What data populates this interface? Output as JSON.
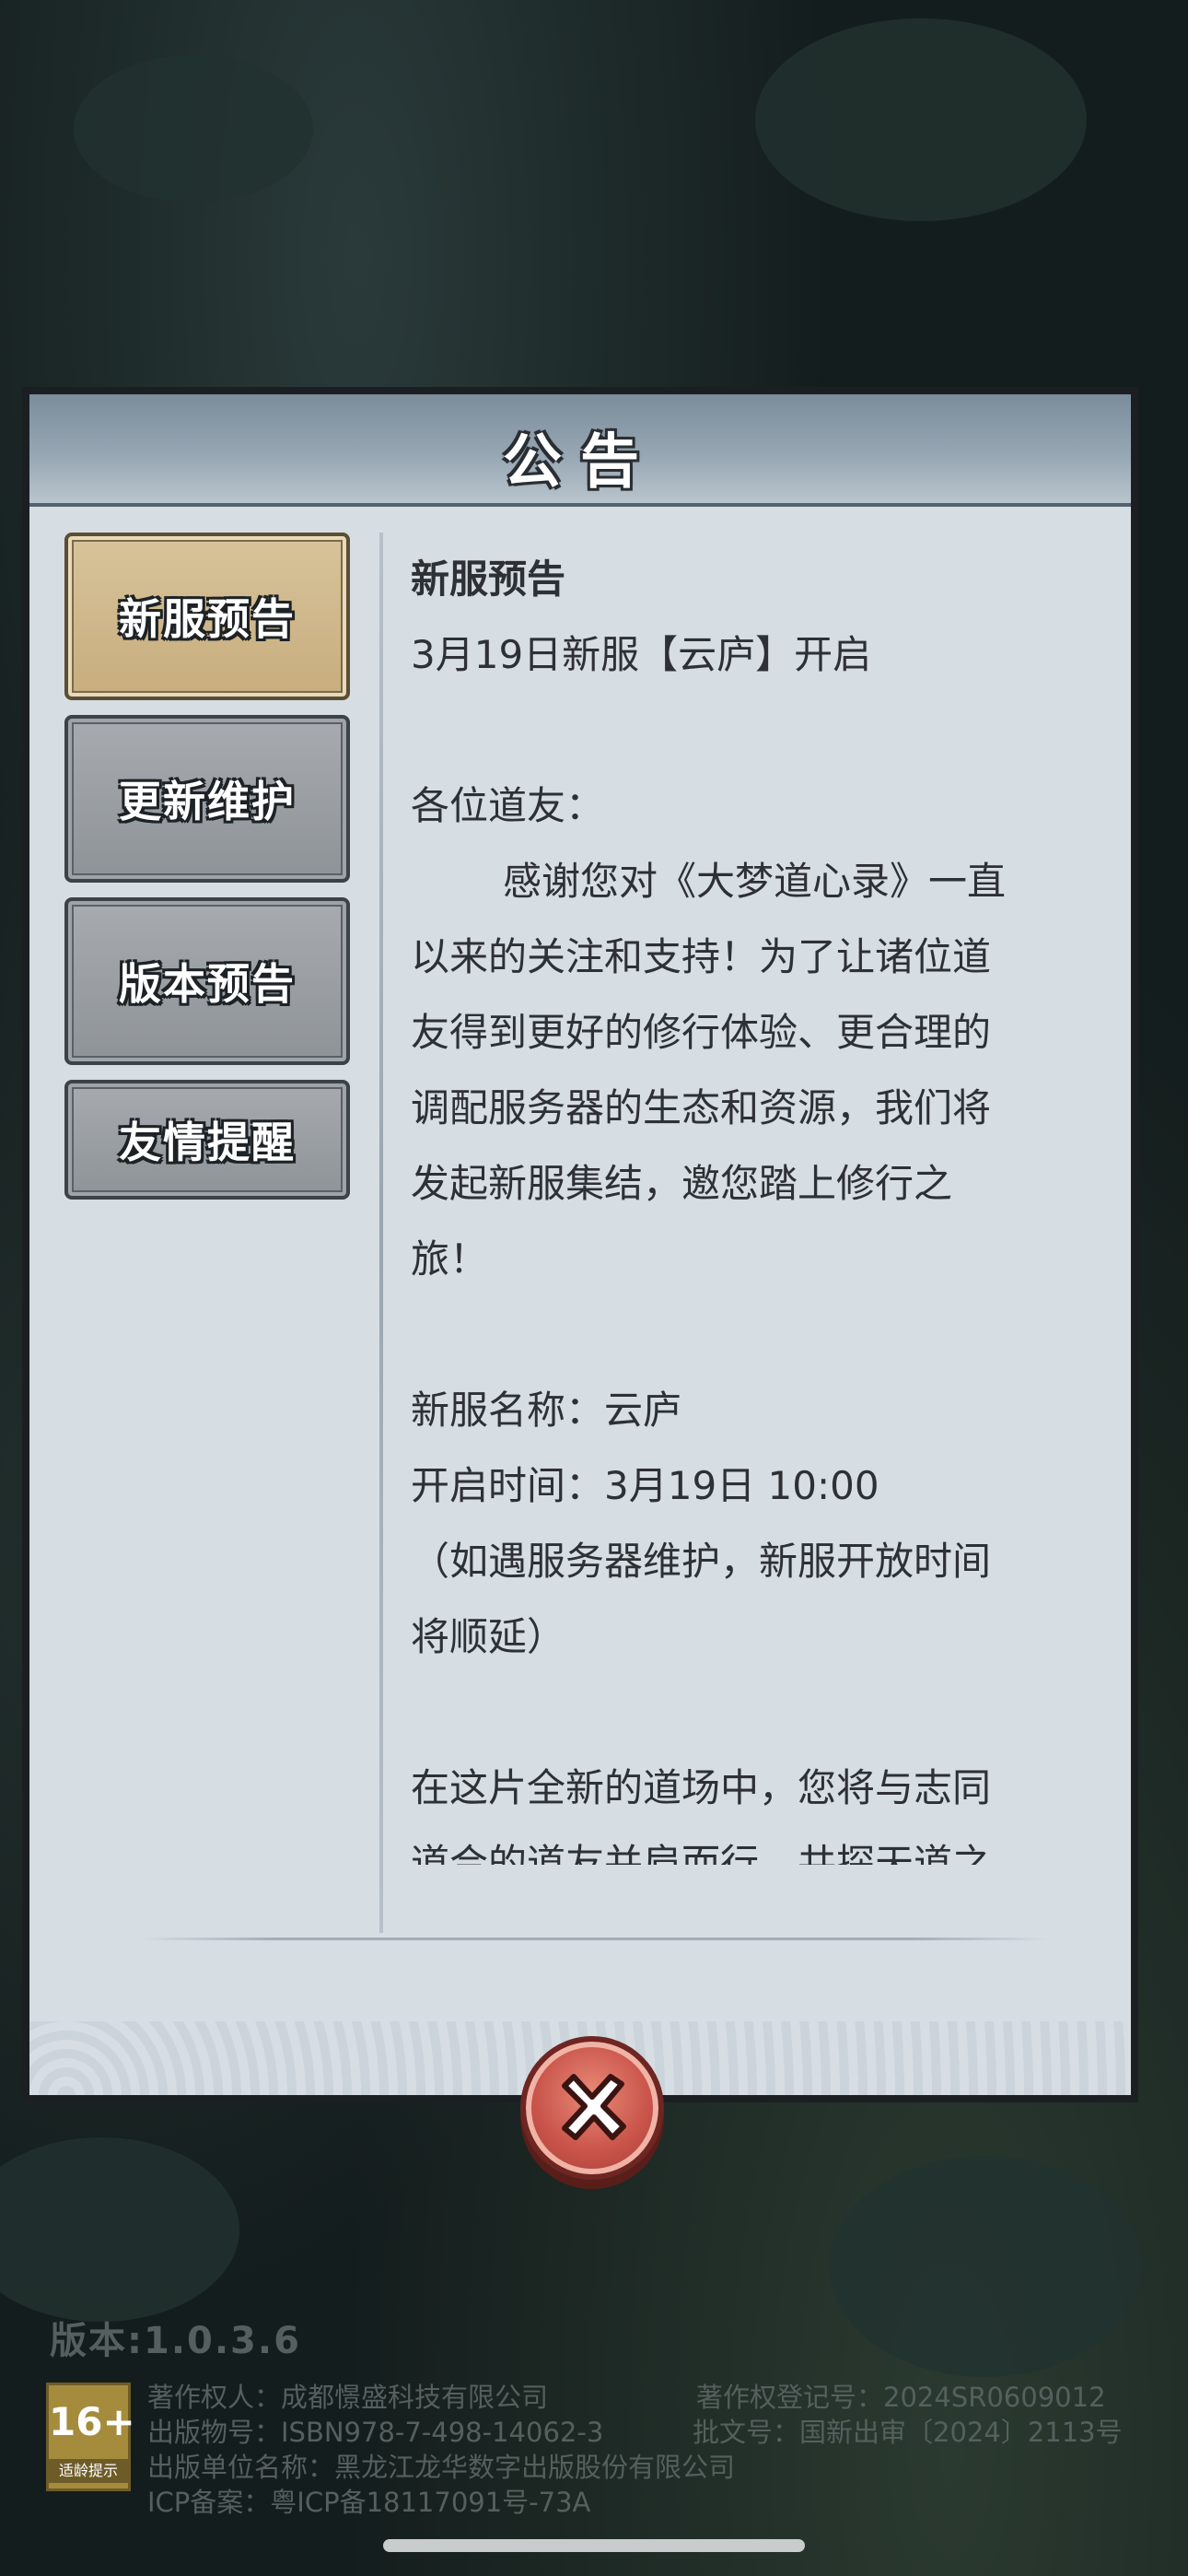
{
  "dialog": {
    "title": "公告"
  },
  "tabs": [
    {
      "label": "新服预告",
      "active": true
    },
    {
      "label": "更新维护",
      "active": false
    },
    {
      "label": "版本预告",
      "active": false
    },
    {
      "label": "友情提醒",
      "active": false
    }
  ],
  "announcement": {
    "title": "新服预告",
    "headline": "3月19日新服【云庐】开启",
    "greeting": "各位道友：",
    "paragraph_lines": [
      "感谢您对《大梦道心录》一直",
      "以来的关注和支持！为了让诸位道",
      "友得到更好的修行体验、更合理的",
      "调配服务器的生态和资源，我们将",
      "发起新服集结，邀您踏上修行之",
      "旅！"
    ],
    "server_name": "新服名称：云庐",
    "open_time": "开启时间：3月19日 10:00",
    "note_lines": [
      "（如遇服务器维护，新服开放时间",
      "将顺延）"
    ],
    "more_lines": [
      "在这片全新的道场中，您将与志同",
      "道合的道友并肩而行，共探天道之"
    ]
  },
  "footer": {
    "version": "版本:1.0.3.6",
    "age_rating": "16+",
    "age_hint": "适龄提示",
    "copyright_holder": "著作权人：成都憬盛科技有限公司",
    "copyright_reg": "著作权登记号：2024SR0609012",
    "publication_no": "出版物号：ISBN978-7-498-14062-3",
    "approval_no": "批文号：国新出审〔2024〕2113号",
    "publisher": "出版单位名称：黑龙江龙华数字出版股份有限公司",
    "icp": "ICP备案：粤ICP备18117091号-73A"
  },
  "colors": {
    "close_button": "#c9544a",
    "active_tab": "#d2bb8d",
    "panel": "#d6dde3"
  }
}
